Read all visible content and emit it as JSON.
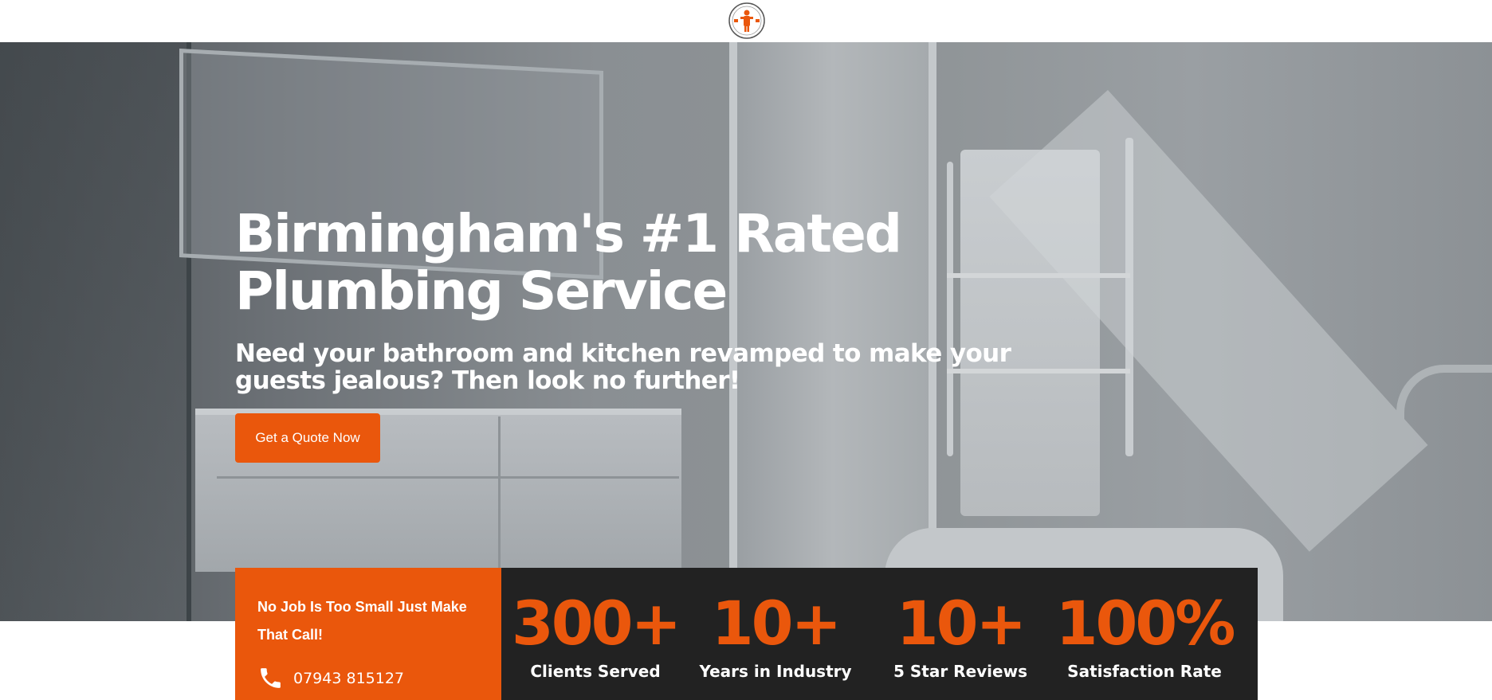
{
  "brand": {
    "logo_icon": "plumber-logo-icon",
    "accent_color": "#ea570c"
  },
  "hero": {
    "headline": "Birmingham's #1 Rated Plumbing Service",
    "subheadline": "Need your bathroom and kitchen revamped to make your guests jealous? Then look no further!",
    "cta_label": "Get a Quote Now"
  },
  "callout": {
    "text": "No Job Is Too Small Just Make That Call!",
    "phone_icon": "phone-icon",
    "phone": "07943 815127"
  },
  "stats": [
    {
      "value": "300+",
      "label": "Clients Served"
    },
    {
      "value": "10+",
      "label": "Years in Industry"
    },
    {
      "value": "10+",
      "label": "5 Star Reviews"
    },
    {
      "value": "100%",
      "label": "Satisfaction Rate"
    }
  ]
}
